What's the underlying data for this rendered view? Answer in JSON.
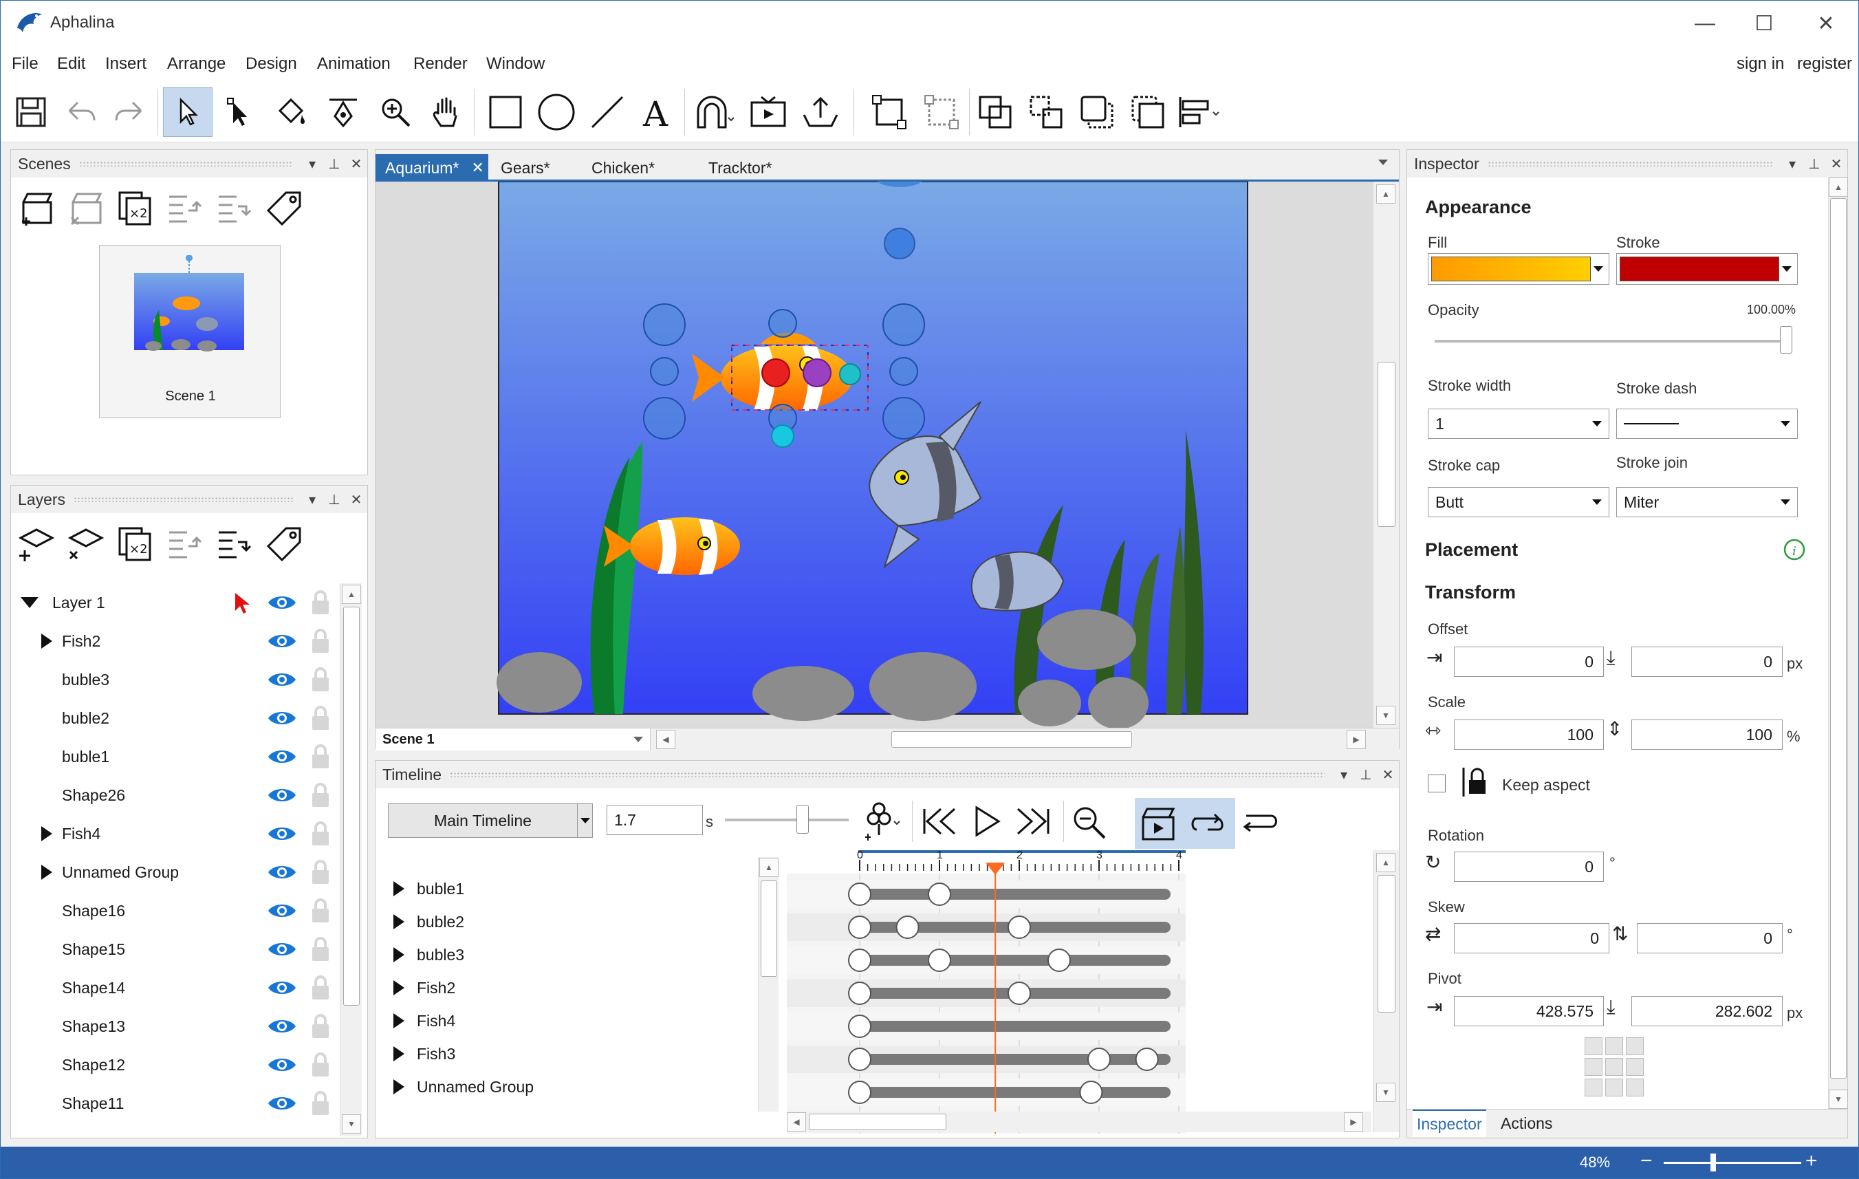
{
  "app": {
    "title": "Aphalina"
  },
  "window_controls": {
    "minimize": "—",
    "maximize": "☐",
    "close": "✕"
  },
  "menu": [
    "File",
    "Edit",
    "Insert",
    "Arrange",
    "Design",
    "Animation",
    "Render",
    "Window"
  ],
  "account": {
    "sign_in": "sign in",
    "register": "register"
  },
  "scenes_panel": {
    "title": "Scenes",
    "scene_label": "Scene 1"
  },
  "layers_panel": {
    "title": "Layers",
    "root": "Layer 1",
    "items": [
      {
        "name": "Fish2",
        "expandable": true
      },
      {
        "name": "buble3",
        "expandable": false
      },
      {
        "name": "buble2",
        "expandable": false
      },
      {
        "name": "buble1",
        "expandable": false
      },
      {
        "name": "Shape26",
        "expandable": false
      },
      {
        "name": "Fish4",
        "expandable": true
      },
      {
        "name": "Unnamed Group",
        "expandable": true
      },
      {
        "name": "Shape16",
        "expandable": false
      },
      {
        "name": "Shape15",
        "expandable": false
      },
      {
        "name": "Shape14",
        "expandable": false
      },
      {
        "name": "Shape13",
        "expandable": false
      },
      {
        "name": "Shape12",
        "expandable": false
      },
      {
        "name": "Shape11",
        "expandable": false
      }
    ]
  },
  "doc_tabs": [
    {
      "label": "Aquarium*",
      "active": true
    },
    {
      "label": "Gears*",
      "active": false
    },
    {
      "label": "Chicken*",
      "active": false
    },
    {
      "label": "Tracktor*",
      "active": false
    }
  ],
  "canvas": {
    "scene_selector": "Scene 1"
  },
  "timeline": {
    "title": "Timeline",
    "timeline_select": "Main Timeline",
    "time_value": "1.7",
    "time_unit": "s",
    "ruler_labels": [
      "0",
      "1",
      "2",
      "3",
      "4"
    ],
    "playhead": 1.7,
    "tracks": [
      {
        "name": "buble1",
        "keys": [
          0,
          1.0
        ]
      },
      {
        "name": "buble2",
        "keys": [
          0,
          0.6,
          2.0
        ]
      },
      {
        "name": "buble3",
        "keys": [
          0,
          1.0,
          2.5
        ]
      },
      {
        "name": "Fish2",
        "keys": [
          0,
          2.0
        ]
      },
      {
        "name": "Fish4",
        "keys": [
          0
        ]
      },
      {
        "name": "Fish3",
        "keys": [
          0,
          3.0,
          3.6
        ]
      },
      {
        "name": "Unnamed Group",
        "keys": [
          0,
          2.9
        ]
      }
    ]
  },
  "inspector": {
    "title": "Inspector",
    "appearance": "Appearance",
    "fill_label": "Fill",
    "stroke_label": "Stroke",
    "opacity_label": "Opacity",
    "opacity_value": "100.00%",
    "opacity_fraction": 1.0,
    "stroke_width_label": "Stroke width",
    "stroke_width": "1",
    "stroke_dash_label": "Stroke dash",
    "stroke_cap_label": "Stroke cap",
    "stroke_cap": "Butt",
    "stroke_join_label": "Stroke join",
    "stroke_join": "Miter",
    "placement": "Placement",
    "transform": "Transform",
    "offset_label": "Offset",
    "offset_x": "0",
    "offset_y": "0",
    "px": "px",
    "scale_label": "Scale",
    "scale_x": "100",
    "scale_y": "100",
    "percent": "%",
    "keep_aspect": "Keep aspect",
    "rotation_label": "Rotation",
    "rotation": "0",
    "degree": "°",
    "skew_label": "Skew",
    "skew_x": "0",
    "skew_y": "0",
    "pivot_label": "Pivot",
    "pivot_x": "428.575",
    "pivot_y": "282.602",
    "bottom_tabs": [
      "Inspector",
      "Actions"
    ]
  },
  "status": {
    "zoom": "48%",
    "minus": "−",
    "plus": "+"
  },
  "colors": {
    "accent": "#2b6cb0",
    "fill_from": "#ff9a00",
    "fill_to": "#ffcf00",
    "stroke": "#c00000",
    "water_top": "#7aa9e6",
    "water_bottom": "#3340f5"
  }
}
